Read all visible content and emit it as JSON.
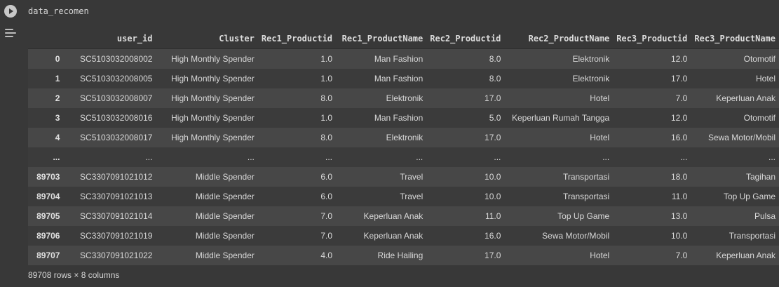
{
  "cell": {
    "code": "data_recomen"
  },
  "table": {
    "columns": [
      "",
      "user_id",
      "Cluster",
      "Rec1_Productid",
      "Rec1_ProductName",
      "Rec2_Productid",
      "Rec2_ProductName",
      "Rec3_Productid",
      "Rec3_ProductName"
    ],
    "rows": [
      [
        "0",
        "SC5103032008002",
        "High Monthly Spender",
        "1.0",
        "Man Fashion",
        "8.0",
        "Elektronik",
        "12.0",
        "Otomotif"
      ],
      [
        "1",
        "SC5103032008005",
        "High Monthly Spender",
        "1.0",
        "Man Fashion",
        "8.0",
        "Elektronik",
        "17.0",
        "Hotel"
      ],
      [
        "2",
        "SC5103032008007",
        "High Monthly Spender",
        "8.0",
        "Elektronik",
        "17.0",
        "Hotel",
        "7.0",
        "Keperluan Anak"
      ],
      [
        "3",
        "SC5103032008016",
        "High Monthly Spender",
        "1.0",
        "Man Fashion",
        "5.0",
        "Keperluan Rumah Tangga",
        "12.0",
        "Otomotif"
      ],
      [
        "4",
        "SC5103032008017",
        "High Monthly Spender",
        "8.0",
        "Elektronik",
        "17.0",
        "Hotel",
        "16.0",
        "Sewa Motor/Mobil"
      ],
      [
        "...",
        "...",
        "...",
        "...",
        "...",
        "...",
        "...",
        "...",
        "..."
      ],
      [
        "89703",
        "SC3307091021012",
        "Middle Spender",
        "6.0",
        "Travel",
        "10.0",
        "Transportasi",
        "18.0",
        "Tagihan"
      ],
      [
        "89704",
        "SC3307091021013",
        "Middle Spender",
        "6.0",
        "Travel",
        "10.0",
        "Transportasi",
        "11.0",
        "Top Up Game"
      ],
      [
        "89705",
        "SC3307091021014",
        "Middle Spender",
        "7.0",
        "Keperluan Anak",
        "11.0",
        "Top Up Game",
        "13.0",
        "Pulsa"
      ],
      [
        "89706",
        "SC3307091021019",
        "Middle Spender",
        "7.0",
        "Keperluan Anak",
        "16.0",
        "Sewa Motor/Mobil",
        "10.0",
        "Transportasi"
      ],
      [
        "89707",
        "SC3307091021022",
        "Middle Spender",
        "4.0",
        "Ride Hailing",
        "17.0",
        "Hotel",
        "7.0",
        "Keperluan Anak"
      ]
    ]
  },
  "footer": {
    "summary": "89708 rows × 8 columns"
  },
  "icons": {
    "run": "play-icon",
    "output": "output-actions-icon"
  }
}
